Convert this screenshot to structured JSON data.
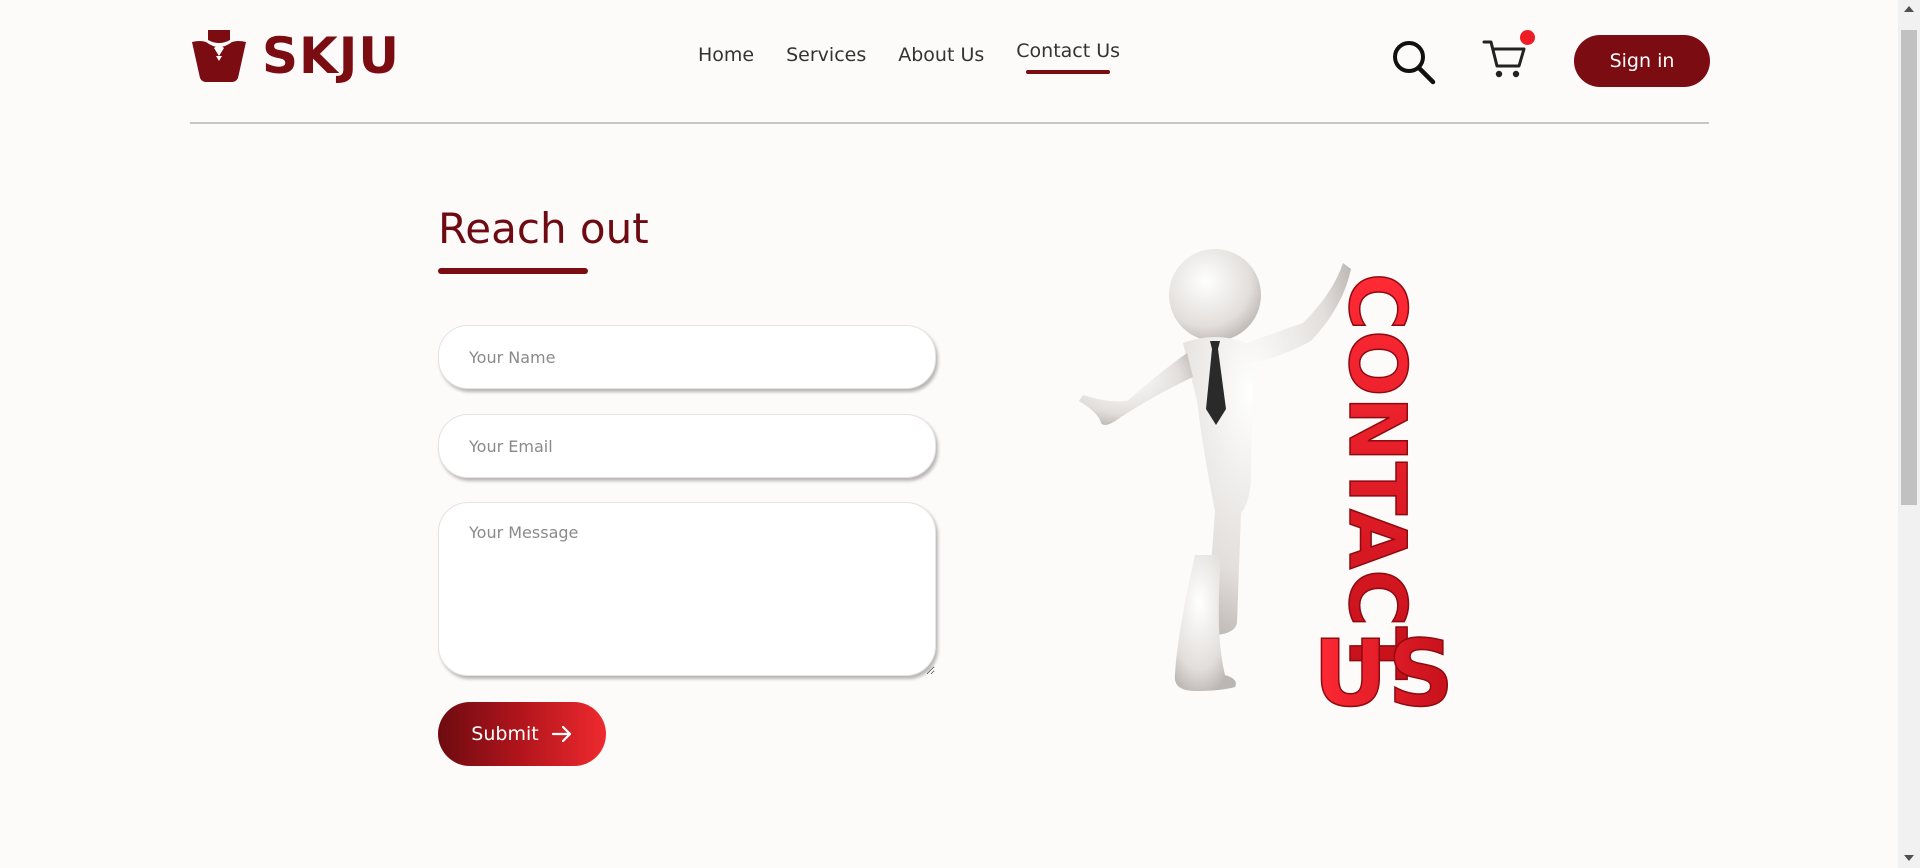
{
  "header": {
    "logo_text": "SKJU",
    "nav": [
      {
        "label": "Home"
      },
      {
        "label": "Services"
      },
      {
        "label": "About Us"
      },
      {
        "label": "Contact Us",
        "active": true
      }
    ],
    "icons": [
      "search-icon",
      "cart-icon"
    ],
    "cart_badge_color": "#ee1c25",
    "signin_label": "Sign in"
  },
  "contact": {
    "title": "Reach out",
    "name_placeholder": "Your Name",
    "email_placeholder": "Your Email",
    "message_placeholder": "Your Message",
    "submit_label": "Submit"
  },
  "illustration": {
    "word_top": "CONTACT",
    "word_bottom": "US"
  },
  "colors": {
    "brand": "#7a0c12",
    "accent_red": "#ee1c25",
    "background": "#fdfafa"
  }
}
